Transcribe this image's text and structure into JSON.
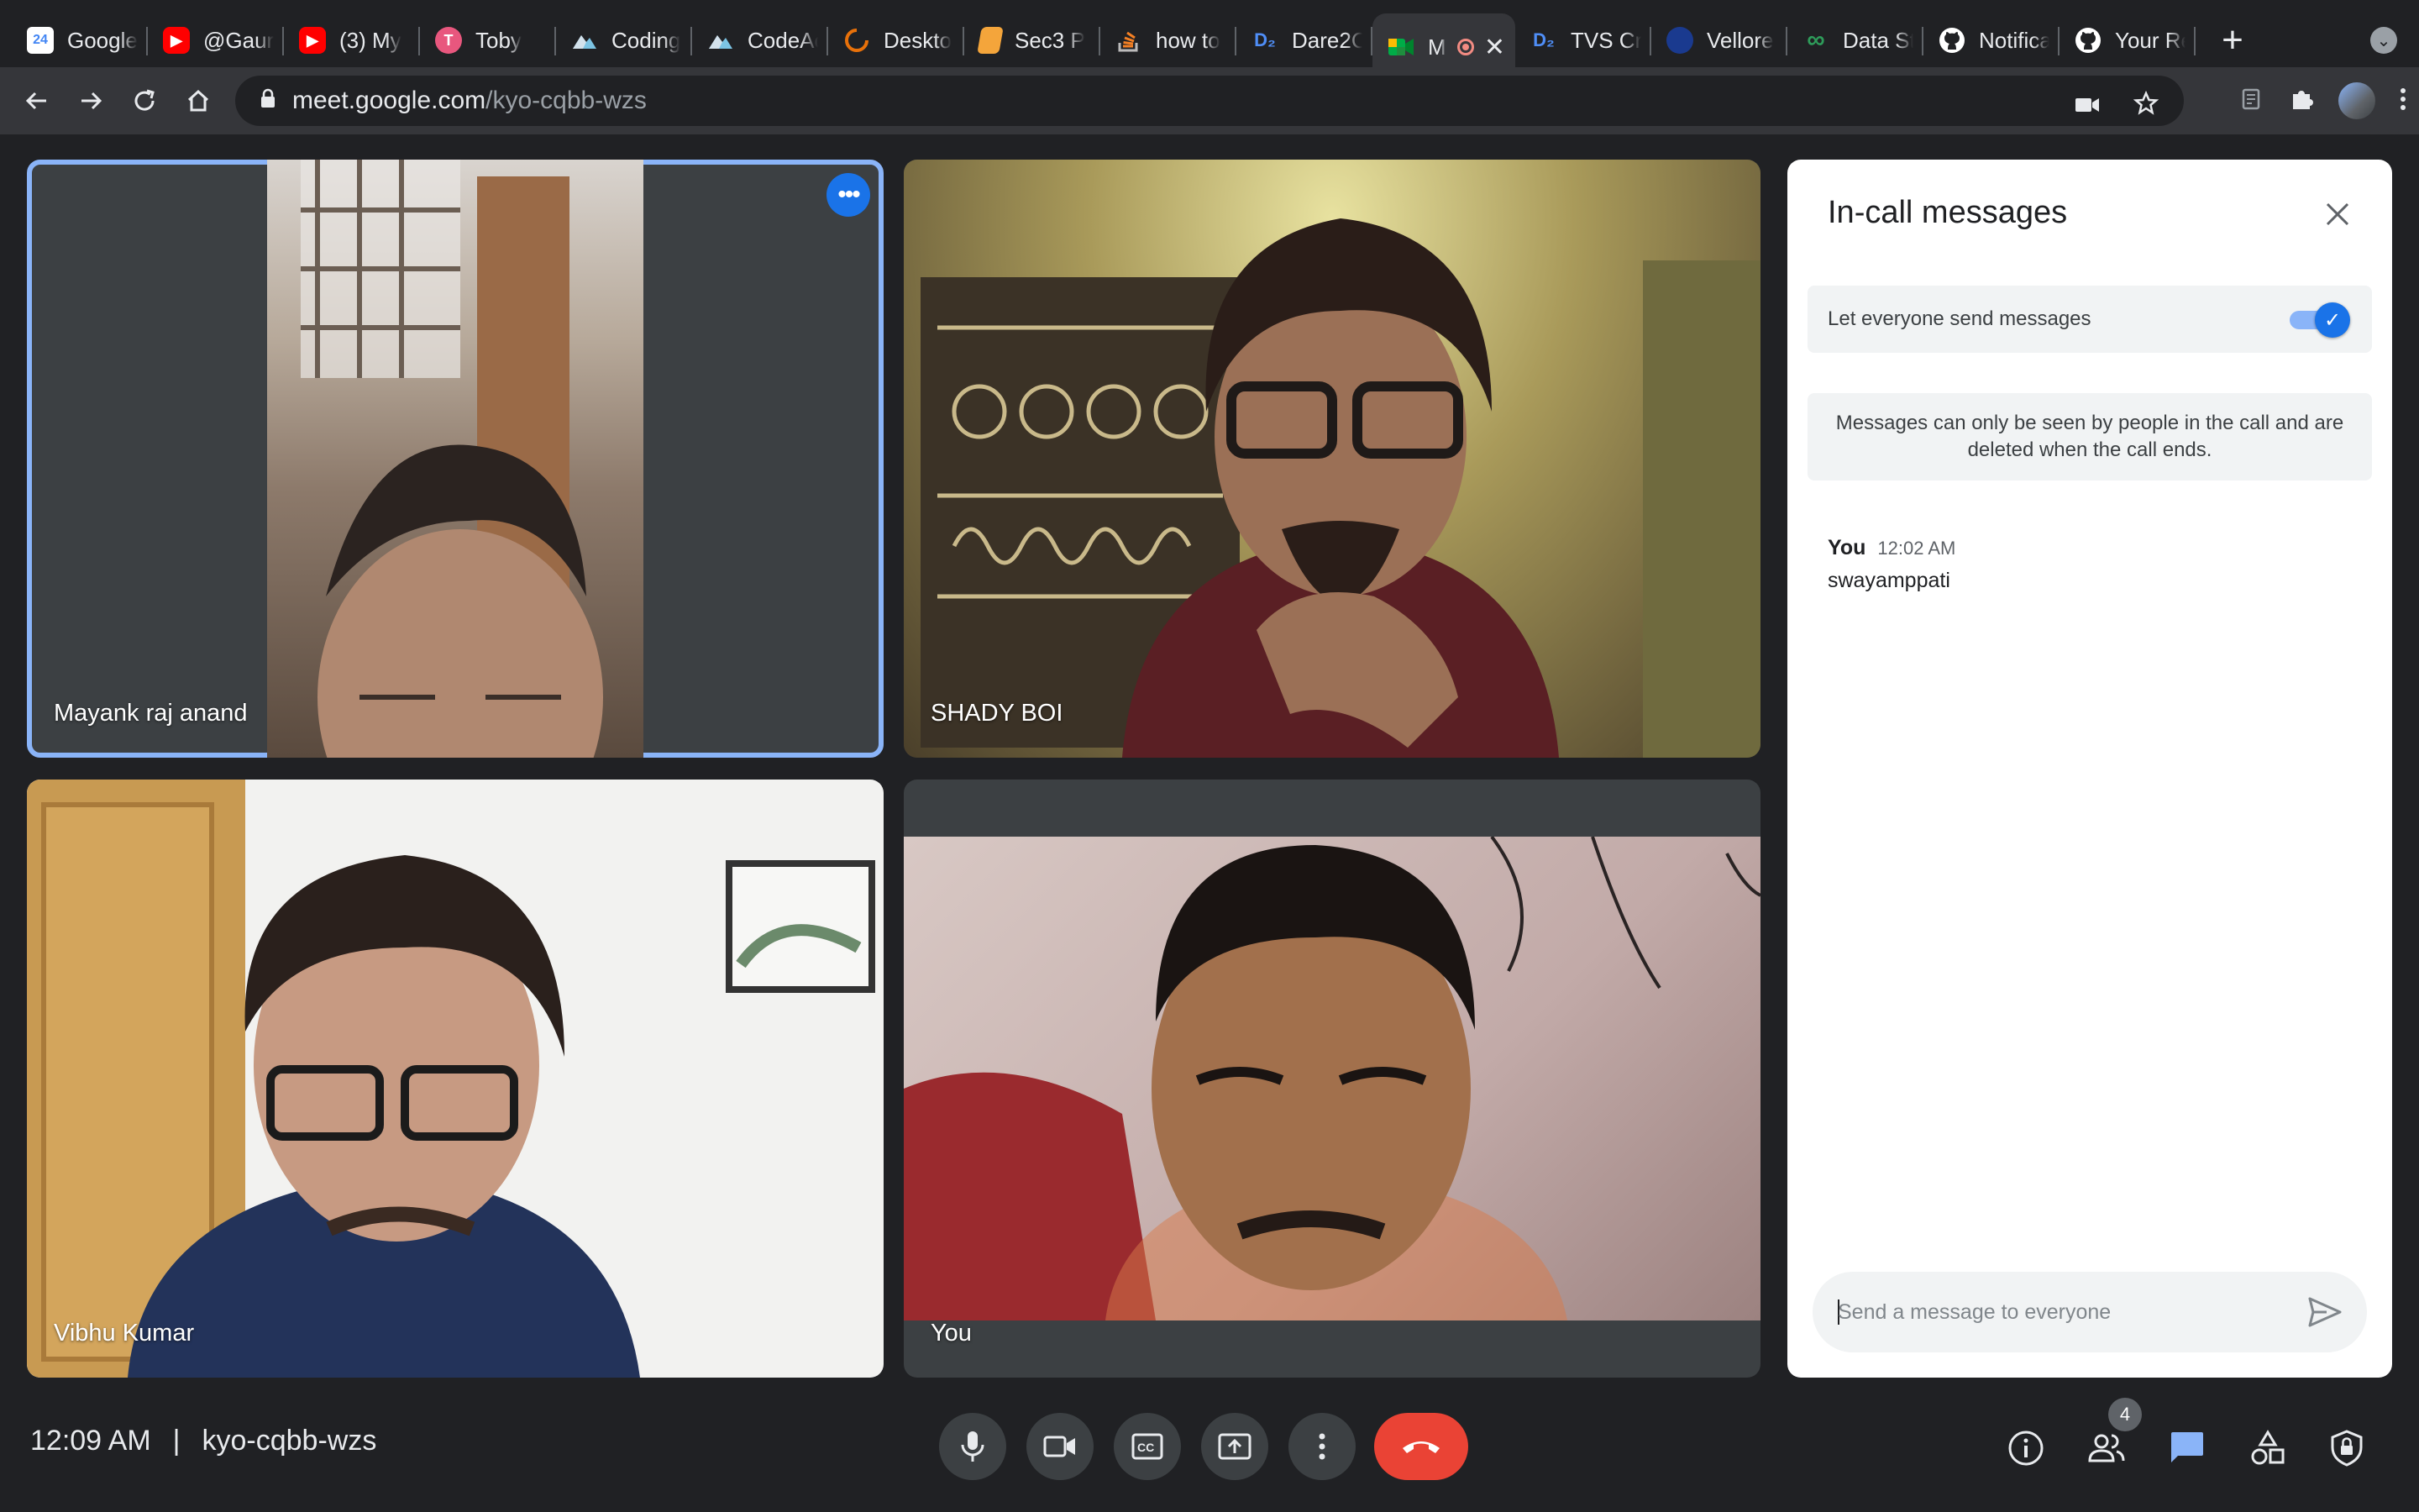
{
  "browser": {
    "tabs": [
      {
        "title": "Google",
        "icon": "calendar-icon",
        "color": "#4285f4"
      },
      {
        "title": "@Gaur",
        "icon": "youtube-icon",
        "color": "#ff0000"
      },
      {
        "title": "(3) My",
        "icon": "youtube-icon",
        "color": "#ff0000"
      },
      {
        "title": "Toby",
        "icon": "toby-icon",
        "color": "#e8577e"
      },
      {
        "title": "Coding",
        "icon": "mountain-icon",
        "color": "#7cc4e4"
      },
      {
        "title": "CodeAc",
        "icon": "mountain-icon",
        "color": "#7cc4e4"
      },
      {
        "title": "Deskto",
        "icon": "loader-icon",
        "color": "#e8710a"
      },
      {
        "title": "Sec3 P",
        "icon": "book-icon",
        "color": "#f4a53b"
      },
      {
        "title": "how to",
        "icon": "stackoverflow-icon",
        "color": "#f48024"
      },
      {
        "title": "Dare2C",
        "icon": "d2c-icon",
        "color": "#4f8ef7"
      },
      {
        "title": "M",
        "icon": "meet-icon",
        "color": "#00897b",
        "active": true
      },
      {
        "title": "TVS Cr",
        "icon": "d2c-icon",
        "color": "#4f8ef7"
      },
      {
        "title": "Vellore",
        "icon": "university-icon",
        "color": "#1a3a8f"
      },
      {
        "title": "Data St",
        "icon": "infinity-icon",
        "color": "#2e9c5a"
      },
      {
        "title": "Notifica",
        "icon": "github-icon",
        "color": "#ffffff"
      },
      {
        "title": "Your Re",
        "icon": "github-icon",
        "color": "#ffffff"
      }
    ],
    "url_host": "meet.google.com",
    "url_path": "/kyo-cqbb-wzs"
  },
  "participants": [
    {
      "name": "Mayank raj anand",
      "speaking": true
    },
    {
      "name": "SHADY BOI"
    },
    {
      "name": "Vibhu Kumar"
    },
    {
      "name": "You"
    }
  ],
  "chat": {
    "title": "In-call messages",
    "toggle_label": "Let everyone send messages",
    "toggle_on": true,
    "info": "Messages can only be seen by people in the call and are deleted when the call ends.",
    "messages": [
      {
        "sender": "You",
        "time": "12:02 AM",
        "text": "swayamppati"
      }
    ],
    "placeholder": "Send a message to everyone"
  },
  "meeting": {
    "time": "12:09 AM",
    "separator": "|",
    "code": "kyo-cqbb-wzs",
    "participant_count": "4"
  },
  "colors": {
    "accent": "#8ab4f8",
    "hangup": "#ea4335",
    "chat_active": "#8ab4f8"
  }
}
